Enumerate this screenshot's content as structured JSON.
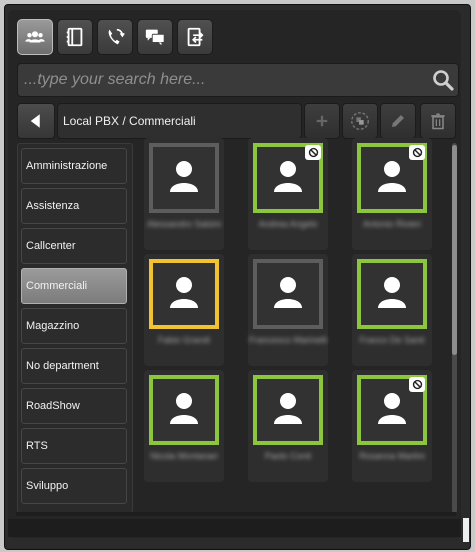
{
  "toolbar": {
    "buttons": [
      {
        "icon": "contacts-group-icon",
        "active": true
      },
      {
        "icon": "address-book-icon",
        "active": false
      },
      {
        "icon": "call-transfer-icon",
        "active": false
      },
      {
        "icon": "chat-icon",
        "active": false
      },
      {
        "icon": "switch-device-icon",
        "active": false
      }
    ]
  },
  "search": {
    "placeholder": "...type your search here...",
    "value": ""
  },
  "breadcrumb": {
    "path": "Local PBX / Commerciali"
  },
  "actions": [
    "add-icon",
    "group-icon",
    "edit-icon",
    "delete-icon"
  ],
  "departments": [
    {
      "label": "Amministrazione",
      "selected": false
    },
    {
      "label": "Assistenza",
      "selected": false
    },
    {
      "label": "Callcenter",
      "selected": false
    },
    {
      "label": "Commerciali",
      "selected": true
    },
    {
      "label": "Magazzino",
      "selected": false
    },
    {
      "label": "No department",
      "selected": false
    },
    {
      "label": "RoadShow",
      "selected": false
    },
    {
      "label": "RTS",
      "selected": false
    },
    {
      "label": "Sviluppo",
      "selected": false
    }
  ],
  "contacts": [
    {
      "status": "offline",
      "dnd": false,
      "name": "Alessandro Salsini"
    },
    {
      "status": "online",
      "dnd": true,
      "name": "Andrea Angelo"
    },
    {
      "status": "online",
      "dnd": true,
      "name": "Antonio Rivieri"
    },
    {
      "status": "busy",
      "dnd": false,
      "name": "Fabio Grandi"
    },
    {
      "status": "offline",
      "dnd": false,
      "name": "Francesco Marinelli"
    },
    {
      "status": "online",
      "dnd": false,
      "name": "Franco De Santi"
    },
    {
      "status": "online",
      "dnd": false,
      "name": "Nicola Montanari"
    },
    {
      "status": "online",
      "dnd": false,
      "name": "Paolo Conti"
    },
    {
      "status": "online",
      "dnd": true,
      "name": "Rosanna Martini"
    }
  ],
  "colors": {
    "online": "#8cc63f",
    "busy": "#f1c232",
    "offline": "#5d5d5d"
  }
}
